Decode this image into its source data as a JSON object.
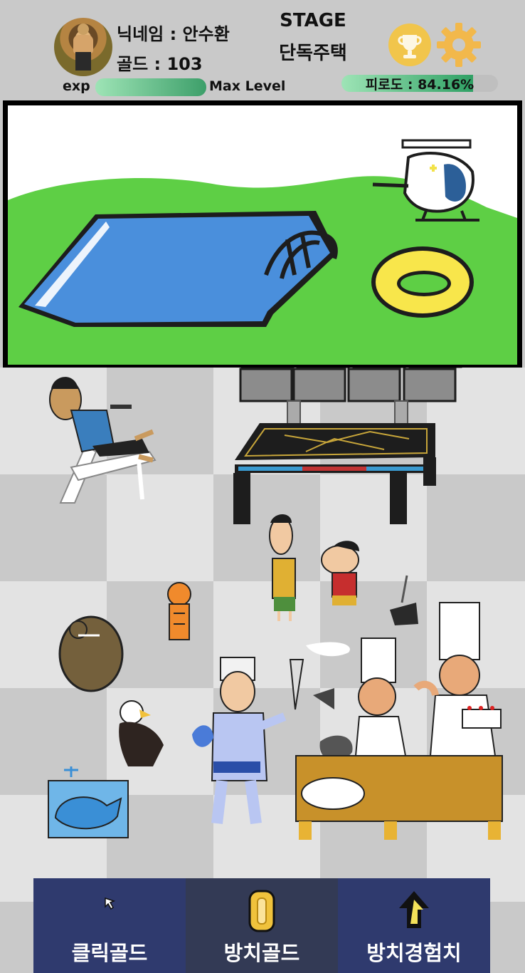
{
  "player": {
    "nickname_text": "닉네임 : 안수환",
    "gold_text": "골드 : 103",
    "exp_label": "exp",
    "exp_fraction": 1.0,
    "level_text": "Max Level"
  },
  "stage": {
    "title": "STAGE",
    "name": "단독주택"
  },
  "fatigue": {
    "text": "피로도 : 84.16%",
    "value_percent": 84.16
  },
  "icons": {
    "achievements": "trophy-icon",
    "settings": "gear-icon",
    "click_gold": "cursor-icon",
    "idle_gold": "coin-icon",
    "idle_exp": "up-arrow-icon"
  },
  "buttons": {
    "click_gold": "클릭골드",
    "idle_gold": "방치골드",
    "idle_exp": "방치경험치"
  },
  "colors": {
    "header_bg": "#c9c9c9",
    "button_bg": "#2f3a6e",
    "exp_bar": "#3d9f6a",
    "grass": "#5ecf45",
    "pool": "#4a8fdc"
  }
}
